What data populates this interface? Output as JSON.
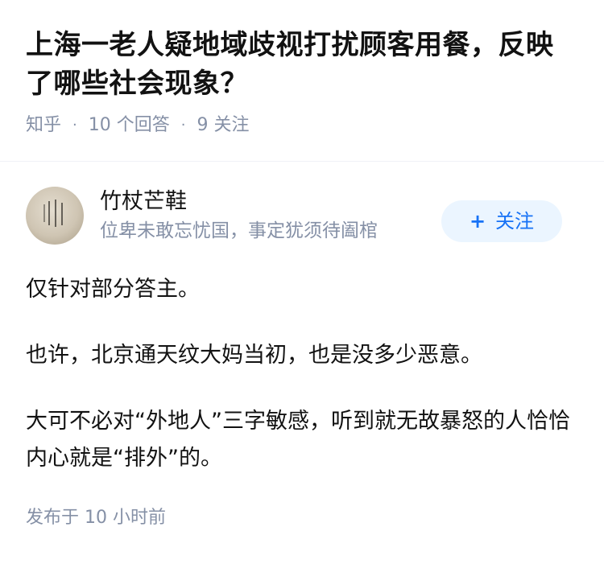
{
  "question": {
    "title": "上海一老人疑地域歧视打扰顾客用餐，反映了哪些社会现象？",
    "source": "知乎",
    "answers": "10 个回答",
    "followers": "9 关注"
  },
  "answer": {
    "author": {
      "name": "竹杖芒鞋",
      "bio": "位卑未敢忘忧国，事定犹须待阖棺",
      "avatar_icon": "calligraphy-avatar"
    },
    "follow_button": {
      "icon": "plus-icon",
      "label": "关注"
    },
    "paragraphs": [
      "仅针对部分答主。",
      "也许，北京通天纹大妈当初，也是没多少恶意。",
      "大可不必对“外地人”三字敏感，听到就无故暴怒的人恰恰内心就是“排外”的。"
    ],
    "published": "发布于  10 小时前"
  },
  "colors": {
    "primary_text": "#121212",
    "secondary_text": "#8590a6",
    "accent": "#1772f6",
    "button_bg": "#ebf5ff"
  }
}
